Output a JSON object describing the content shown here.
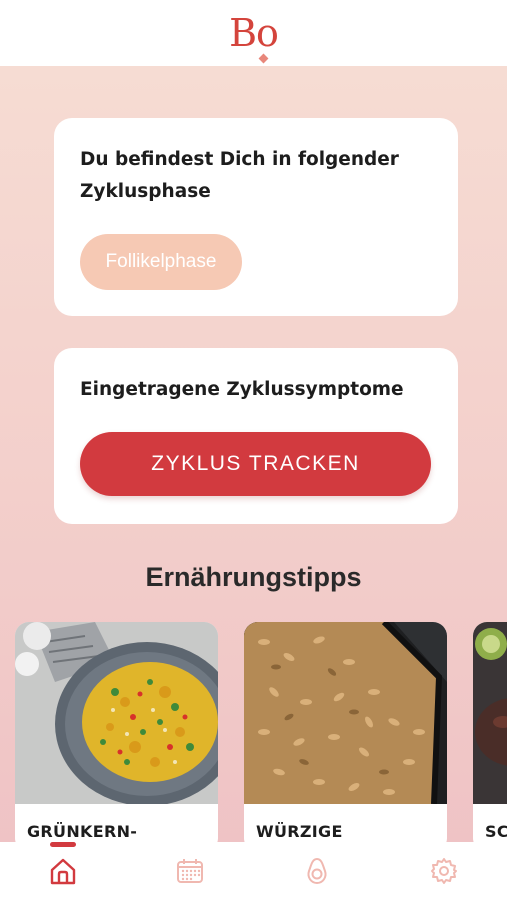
{
  "app": {
    "logo_text": "Bo"
  },
  "phase_card": {
    "title": "Du befindest Dich in folgender Zyklusphase",
    "phase_label": "Follikelphase"
  },
  "symptoms_card": {
    "title": "Eingetragene Zyklussymptome",
    "button_label": "ZYKLUS TRACKEN"
  },
  "nutrition": {
    "section_title": "Ernährungstipps",
    "recipes": [
      {
        "title": "GRÜNKERN-",
        "image": "curry-rice-dish"
      },
      {
        "title": "WÜRZIGE",
        "image": "roasted-seeds-tray"
      },
      {
        "title": "SC",
        "image": "dates-bowl"
      }
    ]
  },
  "nav": {
    "items": [
      {
        "icon": "home-icon",
        "active": true
      },
      {
        "icon": "calendar-icon",
        "active": false
      },
      {
        "icon": "avocado-icon",
        "active": false
      },
      {
        "icon": "settings-icon",
        "active": false
      }
    ]
  },
  "colors": {
    "brand_red": "#d23a3f",
    "phase_pill": "#f6c9b4",
    "inactive_icon": "#f0b8b0"
  }
}
